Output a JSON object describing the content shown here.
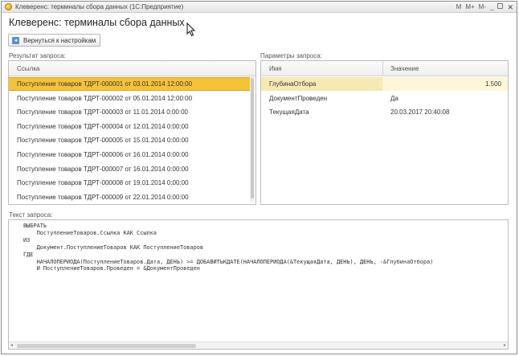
{
  "window": {
    "title": "Клеверенс: терминалы сбора данных (1С:Предприятие)",
    "controls": [
      "M",
      "M+",
      "M-"
    ]
  },
  "page": {
    "title": "Клеверенс: терминалы сбора данных",
    "back_button": "Вернуться к настройкам"
  },
  "results": {
    "label": "Результат запроса:",
    "column": "Ссылка",
    "rows": [
      "Поступление товаров ТДРТ-000001 от 03.01.2014 12:00:00",
      "Поступление товаров ТДРТ-000002 от 05.01.2014 12:00:00",
      "Поступление товаров ТДРТ-000003 от 11.01.2014 0:00:00",
      "Поступление товаров ТДРТ-000004 от 12.01.2014 0:00:00",
      "Поступление товаров ТДРТ-000005 от 15.01.2014 0:00:00",
      "Поступление товаров ТДРТ-000006 от 16.01.2014 0:00:00",
      "Поступление товаров ТДРТ-000007 от 16.01.2014 0:00:00",
      "Поступление товаров ТДРТ-000008 от 19.01.2014 0:00:00",
      "Поступление товаров ТДРТ-000009 от 22.01.2014 0:00:00"
    ],
    "selected_index": 0
  },
  "params": {
    "label": "Параметры запроса:",
    "col_name": "Имя",
    "col_value": "Значение",
    "rows": [
      {
        "name": "ГлубинаОтбора",
        "value": "1.500"
      },
      {
        "name": "ДокументПроведен",
        "value": "Да"
      },
      {
        "name": "ТекущаяДата",
        "value": "20.03.2017 20:40:08"
      }
    ],
    "selected_index": 0
  },
  "query": {
    "label": "Текст запроса:",
    "text": "ВЫБРАТЬ\n    ПоступлениеТоваров.Ссылка КАК Ссылка\nИЗ\n    Документ.ПоступлениеТоваров КАК ПоступлениеТоваров\nГДЕ\n    НАЧАЛОПЕРИОДА(ПоступлениеТоваров.Дата, ДЕНЬ) >= ДОБАВИТЬКДАТЕ(НАЧАЛОПЕРИОДА(&ТекущаяДата, ДЕНЬ), ДЕНЬ, -&ГлубинаОтбора)\n    И ПоступлениеТоваров.Проведен = &ДокументПроведен"
  },
  "colors": {
    "selection": "#f5c33a",
    "param_selection": "#f7e9b4"
  }
}
